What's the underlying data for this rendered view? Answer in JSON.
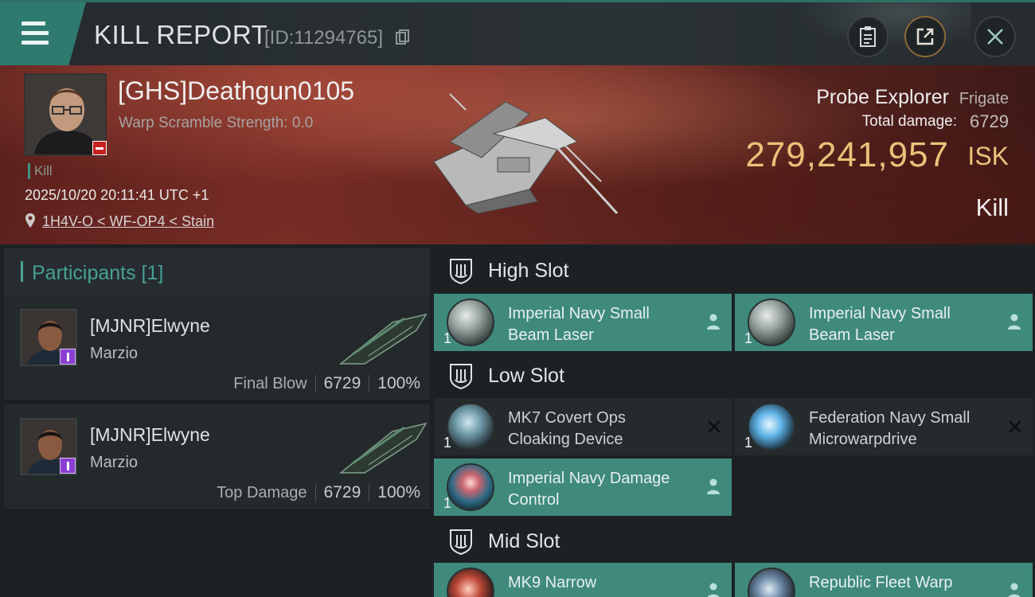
{
  "header": {
    "title": "KILL REPORT",
    "report_id": "[ID:11294765]"
  },
  "victim": {
    "name": "[GHS]Deathgun0105",
    "scramble": "Warp Scramble Strength: 0.0",
    "tag": "Kill",
    "datetime": "2025/10/20 20:11:41 UTC +1",
    "location": "1H4V-O < WF-OP4 < Stain",
    "ship_name": "Probe Explorer",
    "ship_class": "Frigate",
    "total_damage_label": "Total damage:",
    "total_damage": "6729",
    "isk_value": "279,241,957",
    "isk_unit": "ISK",
    "result": "Kill"
  },
  "participants": {
    "title": "Participants [1]",
    "rows": [
      {
        "name": "[MJNR]Elwyne",
        "ship": "Marzio",
        "label": "Final Blow",
        "damage": "6729",
        "percent": "100%"
      },
      {
        "name": "[MJNR]Elwyne",
        "ship": "Marzio",
        "label": "Top Damage",
        "damage": "6729",
        "percent": "100%"
      }
    ]
  },
  "slots": {
    "high": {
      "title": "High Slot",
      "modules": [
        {
          "name": "Imperial Navy Small Beam Laser",
          "qty": "1",
          "state": "fit"
        },
        {
          "name": "Imperial Navy Small Beam Laser",
          "qty": "1",
          "state": "fit"
        }
      ]
    },
    "low": {
      "title": "Low Slot",
      "modules": [
        {
          "name": "MK7 Covert Ops Cloaking Device",
          "qty": "1",
          "state": "destroyed"
        },
        {
          "name": "Federation Navy Small Microwarpdrive",
          "qty": "1",
          "state": "destroyed"
        },
        {
          "name": "Imperial Navy Damage Control",
          "qty": "1",
          "state": "fit"
        }
      ]
    },
    "mid": {
      "title": "Mid Slot",
      "modules": [
        {
          "name": "MK9 Narrow",
          "qty": "1",
          "state": "fit"
        },
        {
          "name": "Republic Fleet Warp",
          "qty": "1",
          "state": "fit"
        }
      ]
    }
  },
  "colors": {
    "accent": "#3f8a7d",
    "isk": "#e9c27a",
    "banner": "#6b2a24"
  },
  "icons": {
    "menu": "menu-icon",
    "copy": "copy-icon",
    "clipboard": "clipboard-icon",
    "share": "share-icon",
    "close": "close-icon",
    "location": "map-pin-icon",
    "slot": "shield-icon",
    "fitted": "person-icon",
    "destroyed": "x-icon"
  }
}
